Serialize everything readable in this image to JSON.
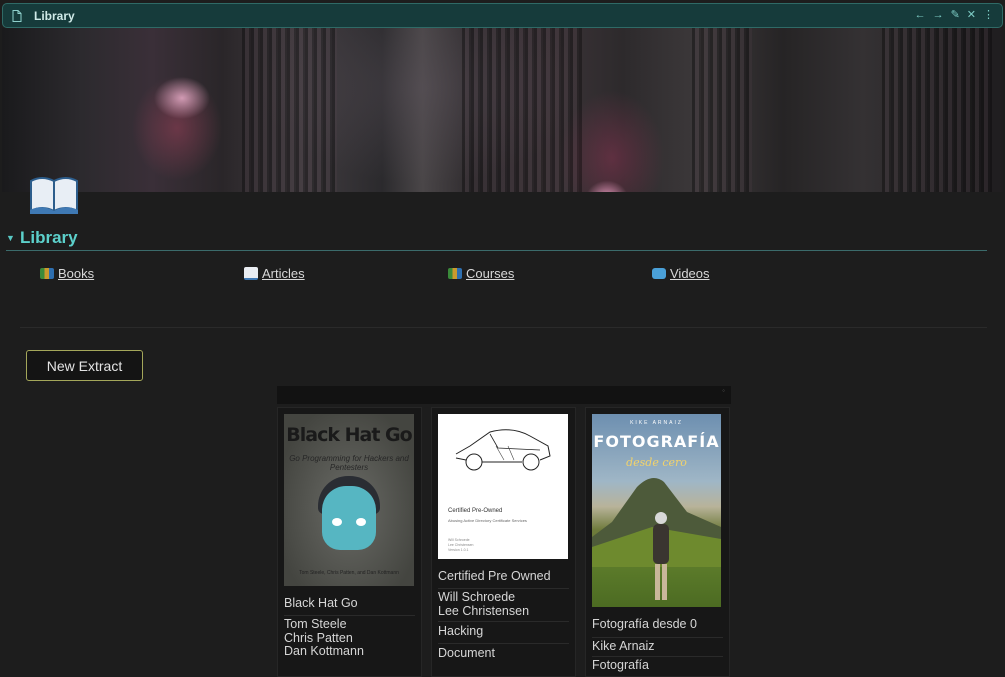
{
  "window": {
    "title": "Library",
    "actions": [
      {
        "name": "back-arrow-icon",
        "glyph": "←"
      },
      {
        "name": "forward-arrow-icon",
        "glyph": "→"
      },
      {
        "name": "edit-pencil-icon",
        "glyph": "✎"
      },
      {
        "name": "close-icon",
        "glyph": "✕"
      },
      {
        "name": "more-menu-icon",
        "glyph": "⋮"
      }
    ]
  },
  "page": {
    "icon": "open-book-icon",
    "heading": "Library"
  },
  "links": [
    {
      "label": "Books",
      "icon": "books-icon"
    },
    {
      "label": "Articles",
      "icon": "open-book-icon"
    },
    {
      "label": "Courses",
      "icon": "books-icon"
    },
    {
      "label": "Videos",
      "icon": "video-icon"
    }
  ],
  "new_extract_label": "New Extract",
  "gallery": {
    "cards": [
      {
        "cover": {
          "title": "Black Hat Go",
          "subtitle": "Go Programming for Hackers and Pentesters",
          "footer": "Tom Steele, Chris Patten, and Dan Kottmann"
        },
        "title": "Black Hat Go",
        "authors": [
          "Tom Steele",
          "Chris Patten",
          "Dan Kottmann"
        ]
      },
      {
        "cover": {
          "title": "Certified Pre-Owned",
          "subtitle": "Abusing Active Directory Certificate Services",
          "footer": [
            "Will Schroede",
            "Lee Christensen",
            "Version 1.0.1"
          ]
        },
        "title": "Certified Pre Owned",
        "authors": [
          "Will Schroede",
          "Lee Christensen"
        ],
        "topic": "Hacking",
        "type": "Document"
      },
      {
        "cover": {
          "author": "KIKE ARNAIZ",
          "title": "FOTOGRAFÍA",
          "subtitle": "desde cero"
        },
        "title": "Fotografía desde 0",
        "authors": [
          "Kike Arnaiz"
        ],
        "topic": "Fotografía"
      }
    ]
  },
  "colors": {
    "background": "#1d1d1d",
    "accent": "#5cd0cb",
    "titlebar": "#163b3b",
    "button_border": "#a4a75a"
  }
}
